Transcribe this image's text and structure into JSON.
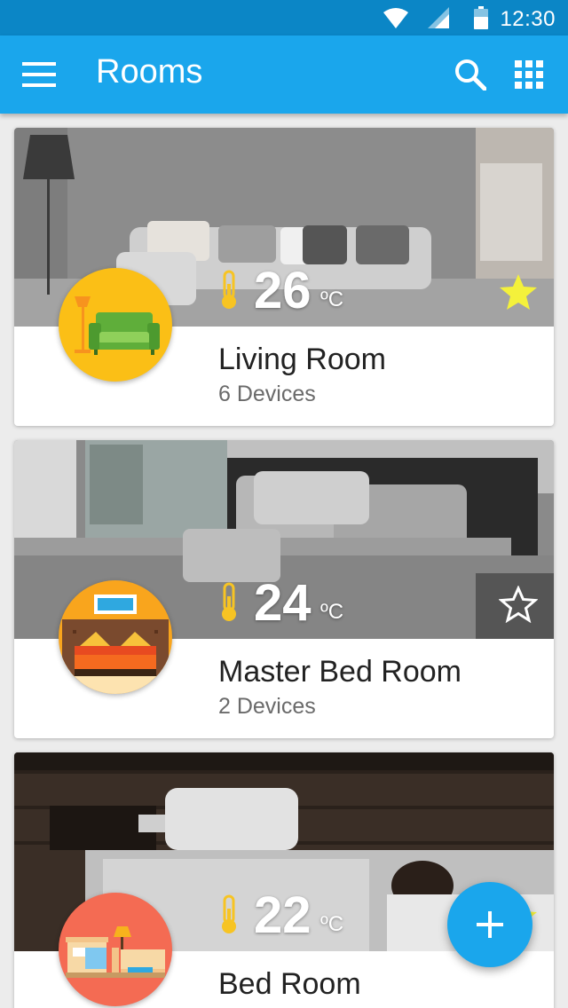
{
  "status_bar": {
    "time": "12:30",
    "icons": [
      "wifi-icon",
      "cell-signal-icon",
      "battery-icon"
    ]
  },
  "app_bar": {
    "title": "Rooms",
    "icons": [
      "menu-icon",
      "search-icon",
      "grid-icon"
    ],
    "color": "#1aa6ec"
  },
  "rooms": [
    {
      "name": "Living Room",
      "devices": "6 Devices",
      "temperature": "26",
      "unit": "ºC",
      "favorite": true,
      "icon": "sofa-icon",
      "icon_bg": "#fbbf16"
    },
    {
      "name": "Master Bed Room",
      "devices": "2 Devices",
      "temperature": "24",
      "unit": "ºC",
      "favorite": false,
      "icon": "bed-icon",
      "icon_bg": "#f9a51d"
    },
    {
      "name": "Bed Room",
      "devices": "",
      "temperature": "22",
      "unit": "ºC",
      "favorite": true,
      "icon": "twin-bed-icon",
      "icon_bg": "#f46b53"
    }
  ],
  "fab": {
    "label": "+",
    "icon": "add-icon"
  },
  "colors": {
    "accent": "#1aa6ec",
    "status_bar": "#0b86c6",
    "star_filled": "#f4f13b",
    "thermometer": "#f7c423"
  }
}
